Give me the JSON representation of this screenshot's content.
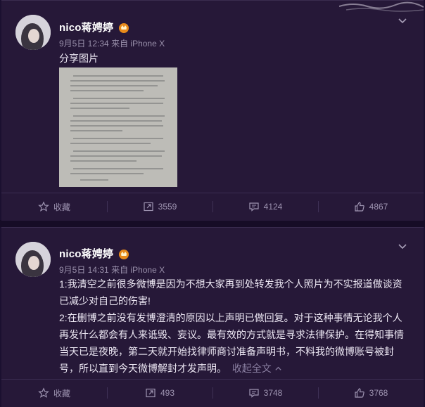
{
  "posts": [
    {
      "author": "nico蒋娉婷",
      "time": "9月5日 12:34",
      "source": "来自 iPhone X",
      "text": "分享图片",
      "actions": {
        "favorite": "收藏",
        "repost": "3559",
        "comment": "4124",
        "like": "4867"
      }
    },
    {
      "author": "nico蒋娉婷",
      "time": "9月5日 14:31",
      "source": "来自 iPhone X",
      "paragraphs": [
        "1:我清空之前很多微博是因为不想大家再到处转发我个人照片为不实报道做谈资已减少对自己的伤害!",
        "2:在删博之前没有发博澄清的原因以上声明已做回复。对于这种事情无论我个人再发什么都会有人来诋毁、妄议。最有效的方式就是寻求法律保护。在得知事情当天已是夜晚，第二天就开始找律师商讨准备声明书，不料我的微博账号被封号，所以直到今天微博解封才发声明。"
      ],
      "collapse": "收起全文",
      "actions": {
        "favorite": "收藏",
        "repost": "493",
        "comment": "3748",
        "like": "3768"
      }
    }
  ],
  "colors": {
    "background": "#1b1030",
    "card": "#261838",
    "muted": "#9a90ab",
    "accent": "#e88a1a"
  },
  "icons": [
    "chevron-down-icon",
    "vip-crown-icon",
    "star-icon",
    "repost-icon",
    "comment-icon",
    "like-icon",
    "chevron-up-icon"
  ]
}
